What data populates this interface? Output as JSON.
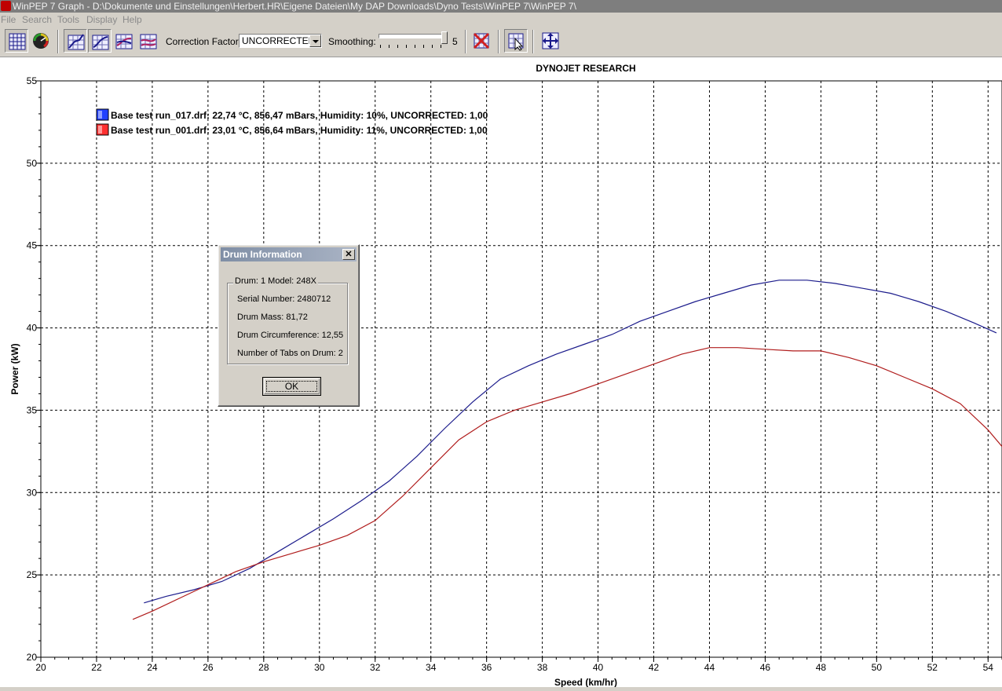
{
  "window": {
    "title": "WinPEP 7    Graph - D:\\Dokumente und Einstellungen\\Herbert.HR\\Eigene Dateien\\My DAP Downloads\\Dyno Tests\\WinPEP 7\\WinPEP 7\\"
  },
  "menu": {
    "file": "File",
    "search": "Search",
    "tools": "Tools",
    "display": "Display",
    "help": "Help"
  },
  "toolbar": {
    "correction_label": "Correction Factor:",
    "correction_value": "UNCORRECTED",
    "smoothing_label": "Smoothing:",
    "smoothing_value": "5",
    "smoothing_level": 1.0
  },
  "dialog": {
    "title": "Drum Information",
    "close": "✕",
    "group": "Drum: 1 Model: 248X",
    "serial": "Serial Number:  2480712",
    "mass": "Drum Mass:  81,72",
    "circumference": "Drum Circumference:  12,55",
    "tabs": "Number of Tabs on Drum:  2",
    "ok": "OK"
  },
  "chart_data": {
    "type": "line",
    "title": "DYNOJET RESEARCH",
    "xlabel": "Speed (km/hr)",
    "ylabel": "Power (kW)",
    "xlim": [
      20,
      54.5
    ],
    "ylim": [
      20,
      55
    ],
    "xticks": [
      "20",
      "22",
      "24",
      "26",
      "28",
      "30",
      "32",
      "34",
      "36",
      "38",
      "40",
      "42",
      "44",
      "46",
      "48",
      "50",
      "52",
      "54"
    ],
    "yticks": [
      "20",
      "25",
      "30",
      "35",
      "40",
      "45",
      "50",
      "55"
    ],
    "grid": true,
    "legend_position": "top-left",
    "series": [
      {
        "name": "Base test run_017.drf: 22,74 °C, 856,47 mBars, Humidity: 10%, UNCORRECTED: 1,00",
        "color": "#1c1c8c",
        "x": [
          23.7,
          24.5,
          25.5,
          26.5,
          27.5,
          28.5,
          29.5,
          30.5,
          31.5,
          32.5,
          33.5,
          34.5,
          35.5,
          36.5,
          37.5,
          38.5,
          39.5,
          40.5,
          41.5,
          42.5,
          43.5,
          44.5,
          45.5,
          46.5,
          47.5,
          48.5,
          49.5,
          50.5,
          51.5,
          52.5,
          53.5,
          54.3
        ],
        "y": [
          23.3,
          23.7,
          24.1,
          24.6,
          25.4,
          26.4,
          27.4,
          28.4,
          29.5,
          30.7,
          32.2,
          33.9,
          35.5,
          36.9,
          37.7,
          38.4,
          39.0,
          39.6,
          40.4,
          41.0,
          41.6,
          42.1,
          42.6,
          42.9,
          42.9,
          42.7,
          42.4,
          42.1,
          41.6,
          41.0,
          40.3,
          39.7
        ]
      },
      {
        "name": "Base test run_001.drf: 23,01 °C, 856,64 mBars, Humidity: 11%, UNCORRECTED: 1,00",
        "color": "#b01c1c",
        "x": [
          23.3,
          24.0,
          25.0,
          26.0,
          27.0,
          28.0,
          29.0,
          30.0,
          31.0,
          32.0,
          33.0,
          34.0,
          35.0,
          36.0,
          37.0,
          38.0,
          39.0,
          40.0,
          41.0,
          42.0,
          43.0,
          44.0,
          45.0,
          46.0,
          47.0,
          48.0,
          49.0,
          50.0,
          51.0,
          52.0,
          53.0,
          54.0,
          54.5
        ],
        "y": [
          22.3,
          22.8,
          23.6,
          24.4,
          25.2,
          25.8,
          26.3,
          26.8,
          27.4,
          28.3,
          29.8,
          31.5,
          33.2,
          34.3,
          35.0,
          35.5,
          36.0,
          36.6,
          37.2,
          37.8,
          38.4,
          38.8,
          38.8,
          38.7,
          38.6,
          38.6,
          38.2,
          37.7,
          37.0,
          36.3,
          35.4,
          33.8,
          32.8
        ]
      }
    ]
  }
}
